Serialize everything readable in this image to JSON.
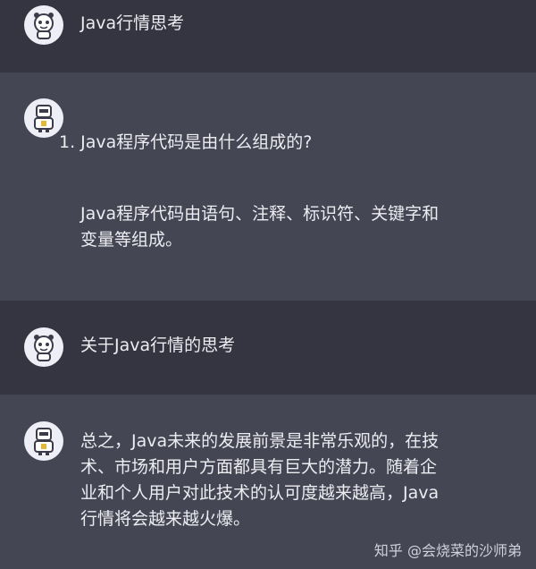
{
  "messages": [
    {
      "role": "user",
      "text": "Java行情思考"
    },
    {
      "role": "assistant",
      "lines": [
        "1. Java程序代码是由什么组成的?",
        "Java程序代码由语句、注释、标识符、关键字和",
        "变量等组成。"
      ]
    },
    {
      "role": "user",
      "text": "关于Java行情的思考"
    },
    {
      "role": "assistant",
      "lines": [
        "总之，Java未来的发展前景是非常乐观的，在技",
        "术、市场和用户方面都具有巨大的潜力。随着企",
        "业和个人用户对此技术的认可度越来越高，Java",
        "行情将会越来越火爆。"
      ]
    }
  ],
  "watermark": "知乎 @会烧菜的沙师弟",
  "icons": {
    "user_avatar": "robot-head-avatar-icon",
    "bot_avatar": "robot-avatar-icon"
  },
  "colors": {
    "user_bg": "#343541",
    "bot_bg": "#444654",
    "text": "#ECECF1",
    "avatar_bg": "#EEEEF6"
  }
}
